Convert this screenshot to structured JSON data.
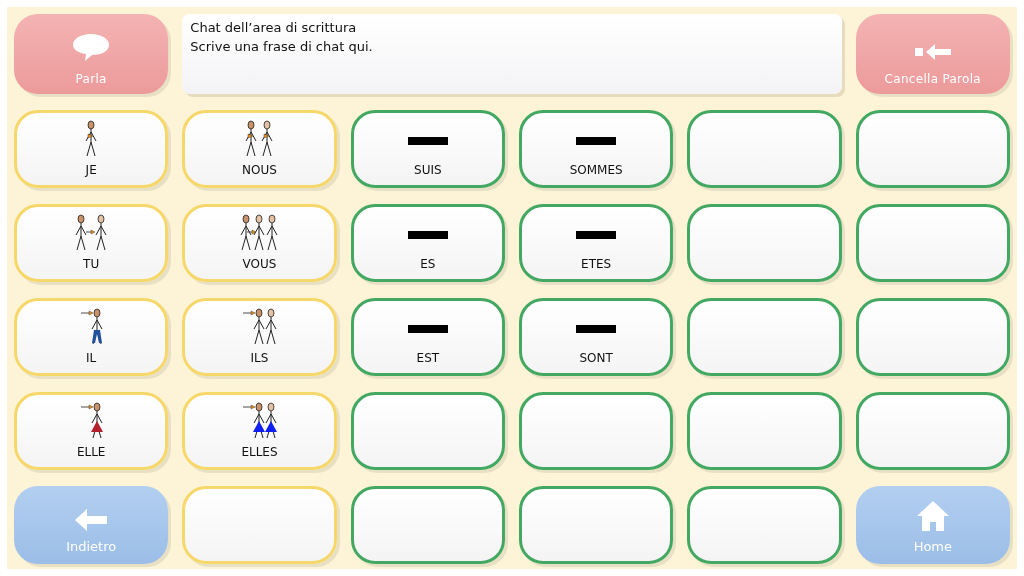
{
  "top_bar": {
    "speak_button": {
      "label": "Parla"
    },
    "message_area": {
      "title": "Chat dell’area di scrittura",
      "text": "Scrive una frase di chat qui."
    },
    "delete_button": {
      "label": "Cancella Parola"
    }
  },
  "grid": {
    "rows": [
      [
        {
          "kind": "pronoun",
          "label": "JE"
        },
        {
          "kind": "pronoun",
          "label": "NOUS"
        },
        {
          "kind": "verb",
          "label": "SUIS"
        },
        {
          "kind": "verb",
          "label": "SOMMES"
        },
        {
          "kind": "verb"
        },
        {
          "kind": "verb"
        }
      ],
      [
        {
          "kind": "pronoun",
          "label": "TU"
        },
        {
          "kind": "pronoun",
          "label": "VOUS"
        },
        {
          "kind": "verb",
          "label": "ES"
        },
        {
          "kind": "verb",
          "label": "ETES"
        },
        {
          "kind": "verb"
        },
        {
          "kind": "verb"
        }
      ],
      [
        {
          "kind": "pronoun",
          "label": "IL"
        },
        {
          "kind": "pronoun",
          "label": "ILS"
        },
        {
          "kind": "verb",
          "label": "EST"
        },
        {
          "kind": "verb",
          "label": "SONT"
        },
        {
          "kind": "verb"
        },
        {
          "kind": "verb"
        }
      ],
      [
        {
          "kind": "pronoun",
          "label": "ELLE"
        },
        {
          "kind": "pronoun",
          "label": "ELLES"
        },
        {
          "kind": "verb"
        },
        {
          "kind": "verb"
        },
        {
          "kind": "verb"
        },
        {
          "kind": "verb"
        }
      ],
      [
        {
          "kind": "nav",
          "label": "Indietro"
        },
        {
          "kind": "pronoun"
        },
        {
          "kind": "verb"
        },
        {
          "kind": "verb"
        },
        {
          "kind": "verb"
        },
        {
          "kind": "nav",
          "label": "Home"
        }
      ]
    ]
  }
}
